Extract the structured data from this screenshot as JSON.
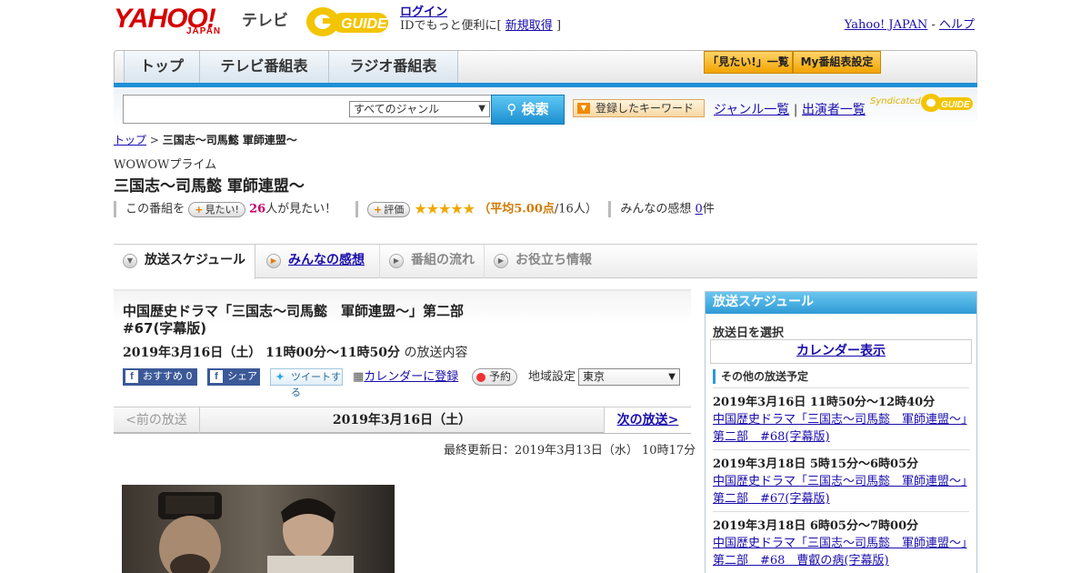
{
  "header": {
    "yahoo_logo": "YAHOO!",
    "yahoo_japan": "JAPAN",
    "tv_label": "テレビ",
    "gguide_logo": "G GUIDE",
    "login_label": "ログイン",
    "login_sub_prefix": "IDでもっと便利に[",
    "register_label": "新規取得",
    "login_sub_suffix": "]",
    "yahoo_japan_link": "Yahoo! JAPAN",
    "separator": " - ",
    "help_link": "ヘルプ"
  },
  "nav": {
    "top": "トップ",
    "tv_schedule": "テレビ番組表",
    "radio_schedule": "ラジオ番組表",
    "mitai_list": "「見たい!」一覧",
    "my_schedule": "My番組表設定"
  },
  "search": {
    "placeholder": "",
    "genre_selected": "すべてのジャンル",
    "search_button": "検索",
    "keyword_button": "登録したキーワード",
    "genre_list": "ジャンル一覧",
    "link_sep": "|",
    "performer_list": "出演者一覧",
    "syndicated": "Syndicated"
  },
  "breadcrumb": {
    "top": "トップ",
    "sep": " > ",
    "current": "三国志～司馬懿 軍師連盟～"
  },
  "program": {
    "channel": "WOWOWプライム",
    "title": "三国志～司馬懿 軍師連盟～",
    "mitai_prefix": "この番組を",
    "mitai_button": "見たい!",
    "mitai_count": "26",
    "mitai_suffix": "人が見たい！",
    "rate_button": "評価",
    "stars": "★★★★★",
    "avg_open": "（",
    "avg_label": "平均5.00点",
    "avg_count": "/16人）",
    "kanso_label": "みんなの感想",
    "kanso_count": "0",
    "kanso_suffix": "件"
  },
  "tabs": {
    "schedule": "放送スケジュール",
    "kanso": "みんなの感想",
    "flow": "番組の流れ",
    "info": "お役立ち情報"
  },
  "episode": {
    "title_line1": "中国歴史ドラマ「三国志～司馬懿　軍師連盟～」第二部",
    "title_line2": "#67(字幕版)",
    "datetime": "2019年3月16日（土）  11時00分～11時50分",
    "datetime_suffix": "の放送内容",
    "fb_recommend": "おすすめ 0",
    "fb_share": "シェア",
    "tweet": "ツイートする",
    "calendar_register": "カレンダーに登録",
    "reserve": "予約",
    "region_label": "地域設定",
    "region_selected": "東京"
  },
  "pager": {
    "prev": "<前の放送",
    "date": "2019年3月16日（土）",
    "next": "次の放送>"
  },
  "updated": "最終更新日：2019年3月13日（水） 10時17分",
  "sidebar": {
    "header": "放送スケジュール",
    "select_date": "放送日を選択",
    "calendar_button": "カレンダー表示",
    "other_heading": "その他の放送予定",
    "items": [
      {
        "when": "2019年3月16日 11時50分～12時40分",
        "title": "中国歴史ドラマ「三国志～司馬懿　軍師連盟～」第二部　#68(字幕版)"
      },
      {
        "when": "2019年3月18日  5時15分～6時05分",
        "title": "中国歴史ドラマ「三国志～司馬懿　軍師連盟～」第二部　#67(字幕版)"
      },
      {
        "when": "2019年3月18日  6時05分～7時00分",
        "title": "中国歴史ドラマ「三国志～司馬懿　軍師連盟～」第二部　#68　曹叡の病(字幕版)"
      }
    ]
  },
  "colors": {
    "accent_blue": "#1e8fd6",
    "link": "#1a0dab",
    "yahoo_red": "#d60000",
    "star": "#f0a800"
  }
}
